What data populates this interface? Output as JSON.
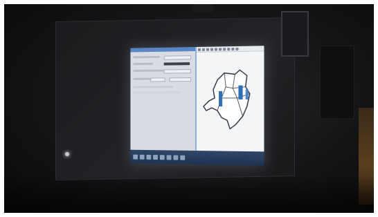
{
  "scene": {
    "description_colors": {
      "wall": "#141416",
      "projection_glow": "#e6e9ee",
      "map_outline": "#2a2f3a",
      "highlight_region": "#2e6fb5",
      "taskbar": "#1f3350"
    }
  },
  "icons": [
    "gis-toolbar-icon",
    "taskbar-app-icon",
    "cursor-icon"
  ]
}
